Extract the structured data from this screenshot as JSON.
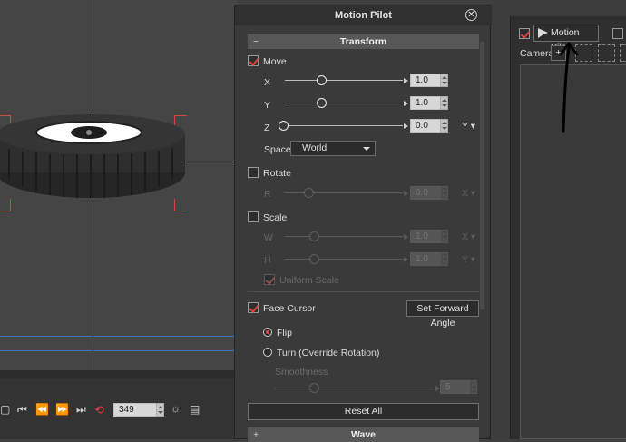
{
  "dialog": {
    "title": "Motion Pilot",
    "transform": {
      "header": "Transform",
      "move": {
        "label": "Move",
        "checked": true,
        "x": {
          "label": "X",
          "value": "1.0"
        },
        "y": {
          "label": "Y",
          "value": "1.0"
        },
        "z": {
          "label": "Z",
          "value": "0.0",
          "axis": "Y"
        },
        "space_label": "Space:",
        "space_value": "World"
      },
      "rotate": {
        "label": "Rotate",
        "checked": false,
        "r_label": "R",
        "value": "0.0",
        "axis": "X"
      },
      "scale": {
        "label": "Scale",
        "checked": false,
        "w_label": "W",
        "w_value": "1.0",
        "w_axis": "X",
        "h_label": "H",
        "h_value": "1.0",
        "h_axis": "Y",
        "uniform_label": "Uniform Scale"
      },
      "face_cursor": {
        "label": "Face Cursor",
        "checked": true,
        "forward_button": "Set Forward Angle",
        "flip_label": "Flip",
        "turn_label": "Turn (Override Rotation)",
        "smoothness_label": "Smoothness",
        "smoothness_value": "5"
      },
      "reset_button": "Reset All"
    },
    "wave_header": "Wave"
  },
  "right_panel": {
    "motion_pilot_label": "Motion Pilot",
    "camera_label": "Camera"
  },
  "timeline": {
    "frame_value": "349"
  },
  "colors": {
    "accent_red": "#e04040",
    "selection_blue": "#3e79b7"
  }
}
